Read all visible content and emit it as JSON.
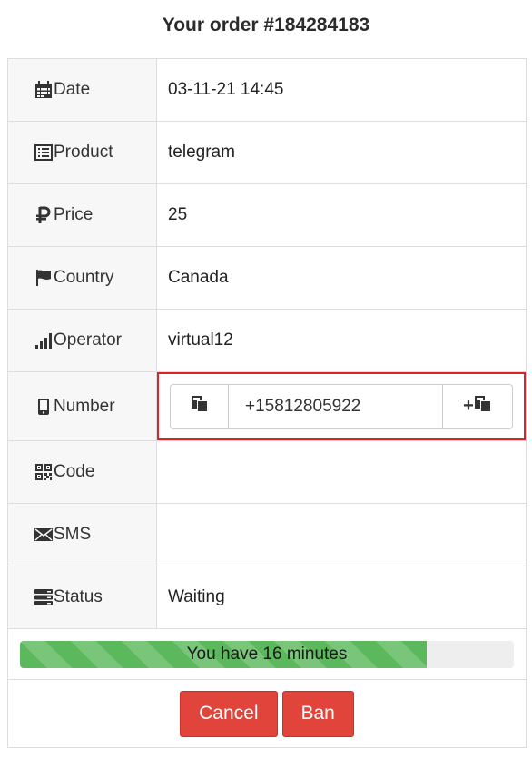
{
  "title": "Your order #184284183",
  "rows": {
    "date": {
      "label": "Date",
      "value": "03-11-21 14:45",
      "icon": "calendar-icon"
    },
    "product": {
      "label": "Product",
      "value": "telegram",
      "icon": "list-icon"
    },
    "price": {
      "label": "Price",
      "value": "25",
      "icon": "ruble-icon"
    },
    "country": {
      "label": "Country",
      "value": "Canada",
      "icon": "flag-icon"
    },
    "operator": {
      "label": "Operator",
      "value": "virtual12",
      "icon": "signal-icon"
    },
    "number": {
      "label": "Number",
      "value": "+15812805922",
      "icon": "mobile-icon"
    },
    "code": {
      "label": "Code",
      "value": "",
      "icon": "qrcode-icon"
    },
    "sms": {
      "label": "SMS",
      "value": "",
      "icon": "envelope-icon"
    },
    "status": {
      "label": "Status",
      "value": "Waiting",
      "icon": "server-icon"
    }
  },
  "number_actions": {
    "copy_icon": "copy-icon",
    "add_copy_label": "+",
    "add_copy_icon": "copy-icon"
  },
  "progress": {
    "text": "You have 16 minutes",
    "fraction": 0.823,
    "color": "#5cb85c"
  },
  "buttons": {
    "cancel": "Cancel",
    "ban": "Ban",
    "color": "#e0443a"
  },
  "highlight_color": "#d9232d"
}
